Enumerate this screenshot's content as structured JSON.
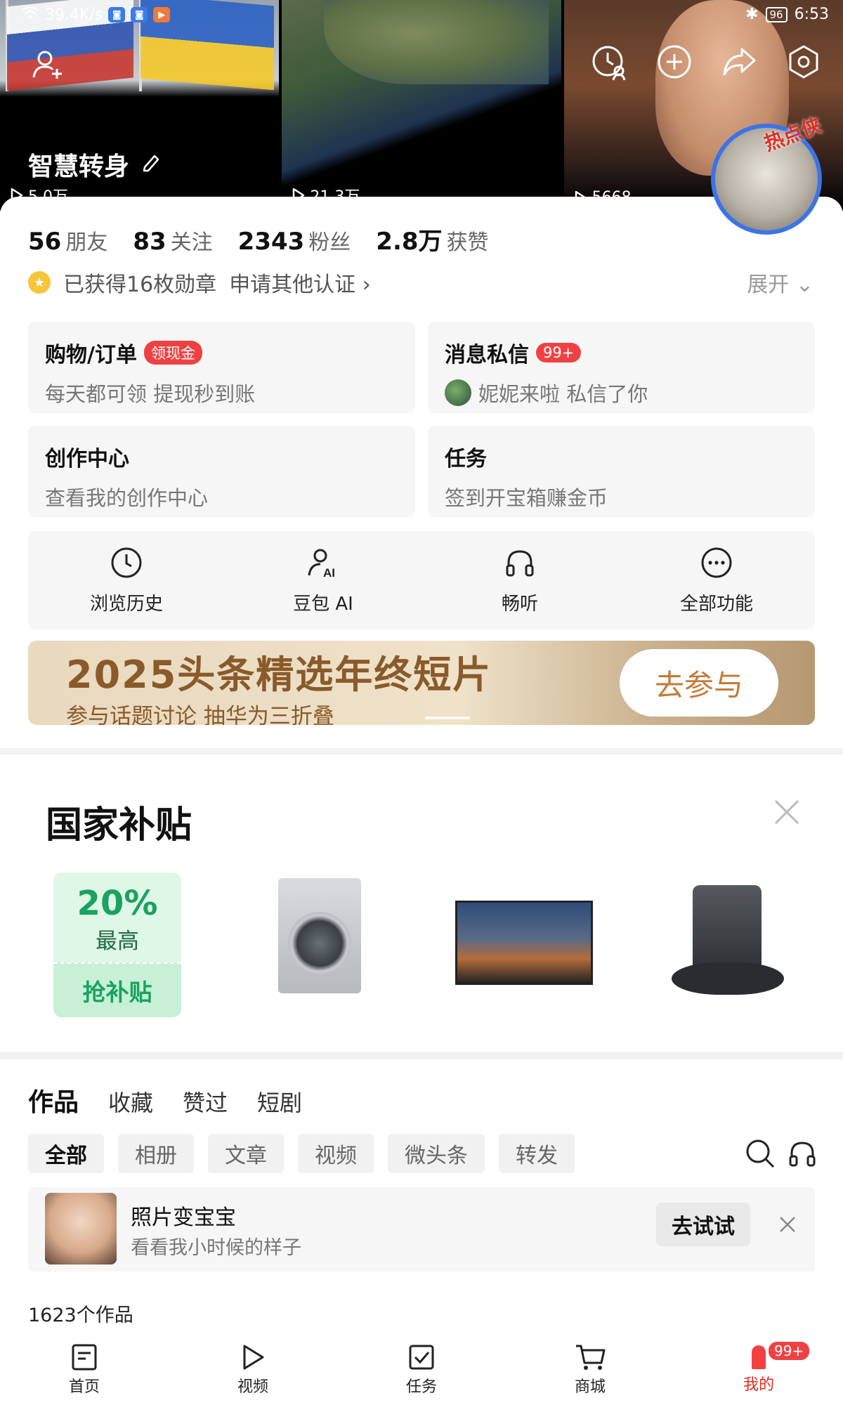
{
  "status_bar": {
    "network_speed": "39.4K/s",
    "battery": "96",
    "time": "6:53"
  },
  "profile": {
    "name": "智慧转身",
    "avatar_badge": "热点侠"
  },
  "top_videos": [
    {
      "plays": "5.0万"
    },
    {
      "plays": "21.3万"
    },
    {
      "plays": "5668"
    }
  ],
  "stats": [
    {
      "num": "56",
      "label": "朋友"
    },
    {
      "num": "83",
      "label": "关注"
    },
    {
      "num": "2343",
      "label": "粉丝"
    },
    {
      "num": "2.8万",
      "label": "获赞"
    }
  ],
  "medals": {
    "text": "已获得16枚勋章",
    "cert_link": "申请其他认证 ›",
    "expand": "展开 ⌄"
  },
  "quick_cards": {
    "shop": {
      "title": "购物/订单",
      "tag": "领现金",
      "sub": "每天都可领 提现秒到账"
    },
    "message": {
      "title": "消息私信",
      "tag": "99+",
      "sub": "妮妮来啦 私信了你"
    },
    "creator": {
      "title": "创作中心",
      "sub": "查看我的创作中心"
    },
    "task": {
      "title": "任务",
      "sub": "签到开宝箱赚金币"
    }
  },
  "features": [
    {
      "label": "浏览历史",
      "icon": "clock-icon"
    },
    {
      "label": "豆包 AI",
      "icon": "ai-user-icon"
    },
    {
      "label": "畅听",
      "icon": "headphones-icon"
    },
    {
      "label": "全部功能",
      "icon": "more-icon"
    }
  ],
  "banner": {
    "title": "2025头条精选年终短片",
    "sub": "参与话题讨论 抽华为三折叠",
    "button": "去参与"
  },
  "subsidy": {
    "title": "国家补贴",
    "coupon_pct": "20%",
    "coupon_max": "最高",
    "coupon_btn": "抢补贴"
  },
  "works": {
    "tabs": [
      "作品",
      "收藏",
      "赞过",
      "短剧"
    ],
    "filters": [
      "全部",
      "相册",
      "文章",
      "视频",
      "微头条",
      "转发"
    ],
    "promo_title": "照片变宝宝",
    "promo_sub": "看看我小时候的样子",
    "promo_btn": "去试试",
    "count": "1623个作品"
  },
  "bottom_nav": [
    {
      "label": "首页",
      "icon": "home-icon"
    },
    {
      "label": "视频",
      "icon": "video-icon"
    },
    {
      "label": "任务",
      "icon": "task-icon"
    },
    {
      "label": "商城",
      "icon": "cart-icon"
    },
    {
      "label": "我的",
      "icon": "mine-icon",
      "badge": "99+"
    }
  ],
  "colors": {
    "accent_red": "#f04142",
    "green": "#1aa260",
    "banner_brown": "#8a5a2a"
  }
}
